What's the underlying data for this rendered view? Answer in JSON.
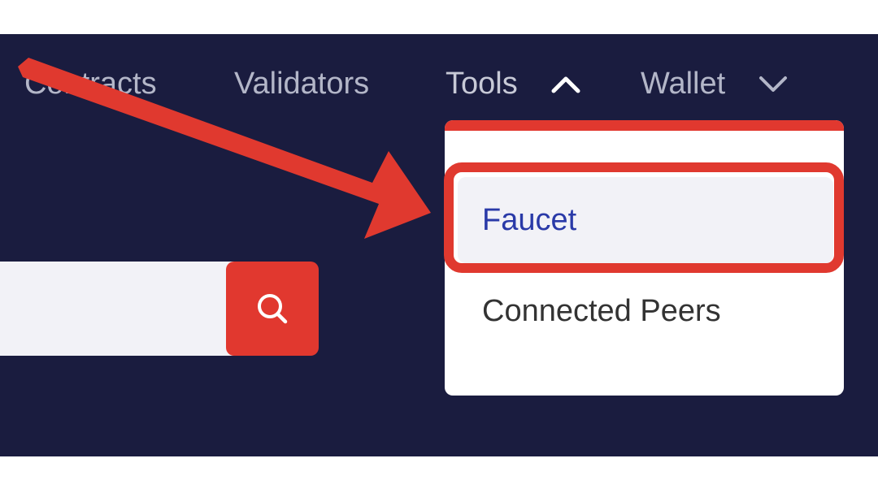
{
  "nav": {
    "items": [
      {
        "label": "Contracts"
      },
      {
        "label": "Validators"
      },
      {
        "label": "Tools"
      },
      {
        "label": "Wallet"
      }
    ]
  },
  "search": {
    "icon": "search-icon",
    "value": ""
  },
  "dropdown": {
    "items": [
      {
        "label": "Faucet"
      },
      {
        "label": "Connected Peers"
      }
    ]
  },
  "colors": {
    "background": "#1a1c3f",
    "accent": "#e1382f",
    "link": "#2a3aa8",
    "annotation": "#e0392f"
  }
}
